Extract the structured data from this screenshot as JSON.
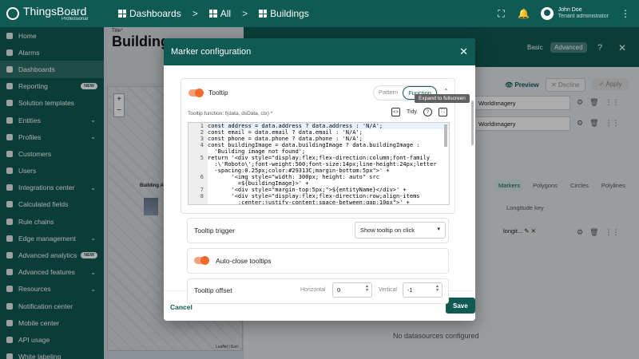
{
  "app": {
    "brand": "ThingsBoard",
    "brand_sub": "Professional"
  },
  "breadcrumb": [
    "Dashboards",
    "All",
    "Buildings"
  ],
  "user": {
    "name": "John Doe",
    "role": "Tenant administrator"
  },
  "sidebar": {
    "items": [
      {
        "label": "Home",
        "chevron": ""
      },
      {
        "label": "Alarms",
        "chevron": ""
      },
      {
        "label": "Dashboards",
        "chevron": "",
        "active": true
      },
      {
        "label": "Reporting",
        "badge": "NEW"
      },
      {
        "label": "Solution templates",
        "chevron": ""
      },
      {
        "label": "Entities",
        "chevron": "⌄"
      },
      {
        "label": "Profiles",
        "chevron": "⌄"
      },
      {
        "label": "Customers",
        "chevron": ""
      },
      {
        "label": "Users",
        "chevron": ""
      },
      {
        "label": "Integrations center",
        "chevron": "⌄"
      },
      {
        "label": "Calculated fields",
        "chevron": ""
      },
      {
        "label": "Rule chains",
        "chevron": ""
      },
      {
        "label": "Edge management",
        "chevron": "⌄"
      },
      {
        "label": "Advanced analytics",
        "badge": "NEW"
      },
      {
        "label": "Advanced features",
        "chevron": "⌄"
      },
      {
        "label": "Resources",
        "chevron": "⌄"
      },
      {
        "label": "Notification center",
        "chevron": ""
      },
      {
        "label": "Mobile center",
        "chevron": ""
      },
      {
        "label": "API usage",
        "chevron": ""
      },
      {
        "label": "White labeling",
        "chevron": ""
      }
    ]
  },
  "dashboard": {
    "title_caption": "Title*",
    "title_text": "Buildings",
    "map_label": "Building A",
    "map_attribution": "Leaflet | Esri",
    "no_datasources": "No datasources configured"
  },
  "settings": {
    "basic": "Basic",
    "advanced": "Advanced",
    "preview": "Preview",
    "decline": "Decline",
    "apply": "Apply",
    "ds_rows": [
      "WorldImagery",
      "WorldImagery"
    ],
    "sub_tabs": [
      "Markers",
      "Polygons",
      "Circles",
      "Polylines"
    ],
    "longitude_key": "Longitude key",
    "chip": "longit..."
  },
  "dialog": {
    "title": "Marker configuration",
    "tooltip_label": "Tooltip",
    "pattern": "Pattern",
    "function": "Function",
    "fullscreen_tooltip": "Expand to fullscreen",
    "function_label": "Tooltip function: f(data, dsData, ctx) *",
    "tidy": "Tidy",
    "code_lines": [
      {
        "n": "1",
        "t": "const address = data.address ? data.address : 'N/A';"
      },
      {
        "n": "2",
        "t": "const email = data.email ? data.email : 'N/A';"
      },
      {
        "n": "3",
        "t": "const phone = data.phone ? data.phone : 'N/A';"
      },
      {
        "n": "4",
        "t": "const buildingImage = data.buildingImage ? data.buildingImage :"
      },
      {
        "n": "",
        "t": "  'Building image not found';"
      },
      {
        "n": "5",
        "t": "return '<div style=\"display:flex;flex-direction:column;font-family"
      },
      {
        "n": "",
        "t": "  :\\'Roboto\\';font-weight:500;font-size:14px;line-height:24px;letter"
      },
      {
        "n": "",
        "t": "  -spacing:0.25px;color:#29313C;margin-bottom:5px\">' +"
      },
      {
        "n": "6",
        "t": "       '<img style=\"width: 300px; height: auto\" src"
      },
      {
        "n": "",
        "t": "         =${buildingImage}>' +"
      },
      {
        "n": "7",
        "t": "       '<div style=\"margin-top:5px;\">${entityName}</div>' +"
      },
      {
        "n": "8",
        "t": "       '<div style=\"display:flex;flex-direction:row;align-items"
      },
      {
        "n": "",
        "t": "         :center;justify-content:space-between;gap:10px\">' +"
      }
    ],
    "trigger_label": "Tooltip trigger",
    "trigger_value": "Show tooltip on click",
    "auto_close": "Auto-close tooltips",
    "offset_label": "Tooltip offset",
    "horizontal": "Horizontal",
    "horizontal_value": "0",
    "vertical": "Vertical",
    "vertical_value": "-1",
    "cancel": "Cancel",
    "save": "Save"
  }
}
